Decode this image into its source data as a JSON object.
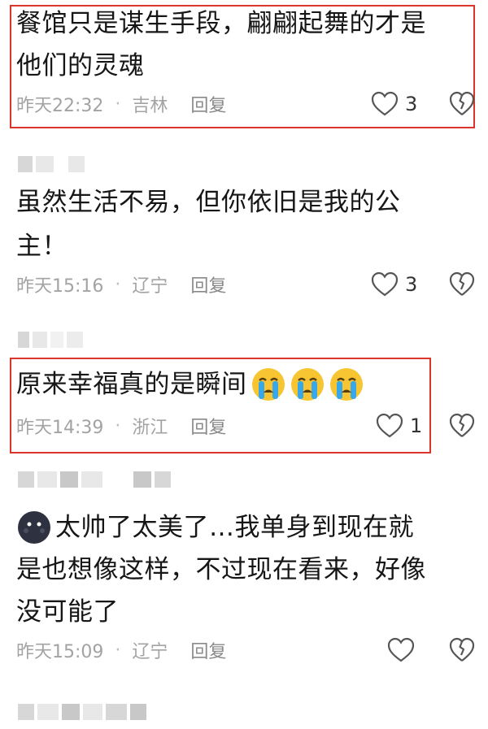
{
  "comments": [
    {
      "lines": [
        "餐馆只是谋生手段，翩翩起舞的才是",
        "他们的灵魂"
      ],
      "time": "昨天22:32",
      "location": "吉林",
      "reply": "回复",
      "likes": "3"
    },
    {
      "lines": [
        "虽然生活不易，但你依旧是我的公",
        "主！"
      ],
      "time": "昨天15:16",
      "location": "辽宁",
      "reply": "回复",
      "likes": "3"
    },
    {
      "lines": [
        "原来幸福真的是瞬间"
      ],
      "emojis": [
        "crying-face-emoji",
        "crying-face-emoji",
        "crying-face-emoji"
      ],
      "time": "昨天14:39",
      "location": "浙江",
      "reply": "回复",
      "likes": "1"
    },
    {
      "lines": [
        "太帅了太美了…我单身到现在就",
        "是也想像这样，不过现在看来，好像",
        "没可能了"
      ],
      "leading_icon": "dark-blob-emoji",
      "time": "昨天15:09",
      "location": "辽宁",
      "reply": "回复",
      "likes": ""
    }
  ],
  "separator": "·",
  "colors": {
    "highlight_box": "#d9352b",
    "meta_text": "#a3a3a3"
  }
}
